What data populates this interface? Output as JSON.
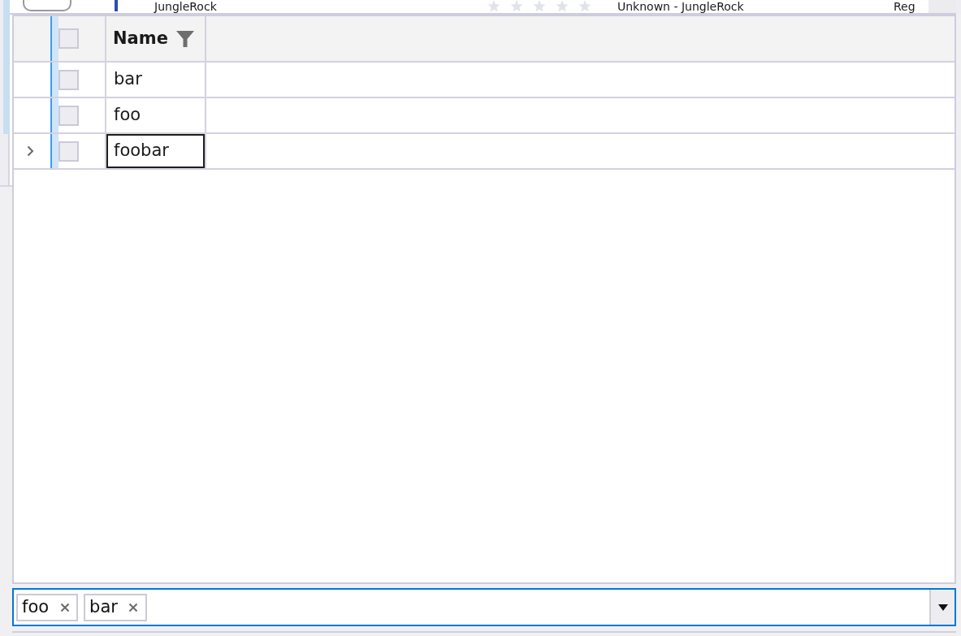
{
  "background_row": {
    "title": "JungleRock",
    "stars": 0,
    "artist": "Unknown - JungleRock",
    "column_5": "Reg"
  },
  "grid": {
    "select_all_checked": false,
    "columns": [
      {
        "label": "Name",
        "filtered": true
      }
    ],
    "rows": [
      {
        "cells": [
          "bar"
        ],
        "checked": false,
        "selected": false
      },
      {
        "cells": [
          "foo"
        ],
        "checked": false,
        "selected": false
      },
      {
        "cells": [
          "foobar"
        ],
        "checked": false,
        "selected": true
      }
    ]
  },
  "filter_box": {
    "tokens": [
      {
        "label": "foo"
      },
      {
        "label": "bar"
      }
    ]
  }
}
